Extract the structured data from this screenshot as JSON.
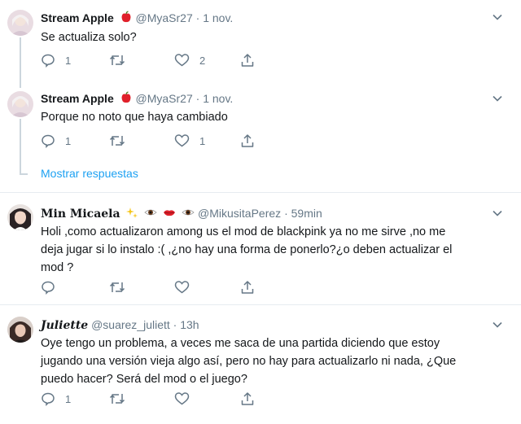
{
  "tweets": [
    {
      "name": "Stream Apple",
      "handle": "@MyaSr27",
      "dot": "·",
      "time": "1 nov.",
      "text": "Se actualiza solo?",
      "replies": "1",
      "retweets": "",
      "likes": "2"
    },
    {
      "name": "Stream Apple",
      "handle": "@MyaSr27",
      "dot": "·",
      "time": "1 nov.",
      "text": "Porque no noto que haya cambiado",
      "replies": "1",
      "retweets": "",
      "likes": "1"
    },
    {
      "name": "Min Micaela",
      "handle": "@MikusitaPerez",
      "dot": "·",
      "time": "59min",
      "text_lines": [
        "Holi ,como actualizaron among us el mod de blackpink ya no me sirve ,no me",
        "deja jugar si lo instalo :( ,¿no hay una forma de ponerlo?¿o deben actualizar el",
        "mod ?"
      ],
      "replies": "",
      "retweets": "",
      "likes": ""
    },
    {
      "name": "Juliette",
      "handle": "@suarez_juliett",
      "dot": "·",
      "time": "13h",
      "text_lines": [
        "Oye tengo un problema, a veces me saca de una partida diciendo que estoy",
        "jugando una versión vieja algo así, pero no hay para actualizarlo ni nada, ¿Que",
        "puedo hacer? Será del mod o el juego?"
      ],
      "replies": "1",
      "retweets": "",
      "likes": ""
    }
  ],
  "show_replies_label": "Mostrar respuestas",
  "icons": {
    "reply": "reply-icon",
    "retweet": "retweet-icon",
    "like": "heart-icon",
    "share": "share-icon",
    "more": "chevron-down-icon",
    "apple": "red-apple-emoji"
  },
  "colors": {
    "secondary_text": "#657786",
    "link": "#1da1f2",
    "thread_line": "#ccd6dd"
  }
}
